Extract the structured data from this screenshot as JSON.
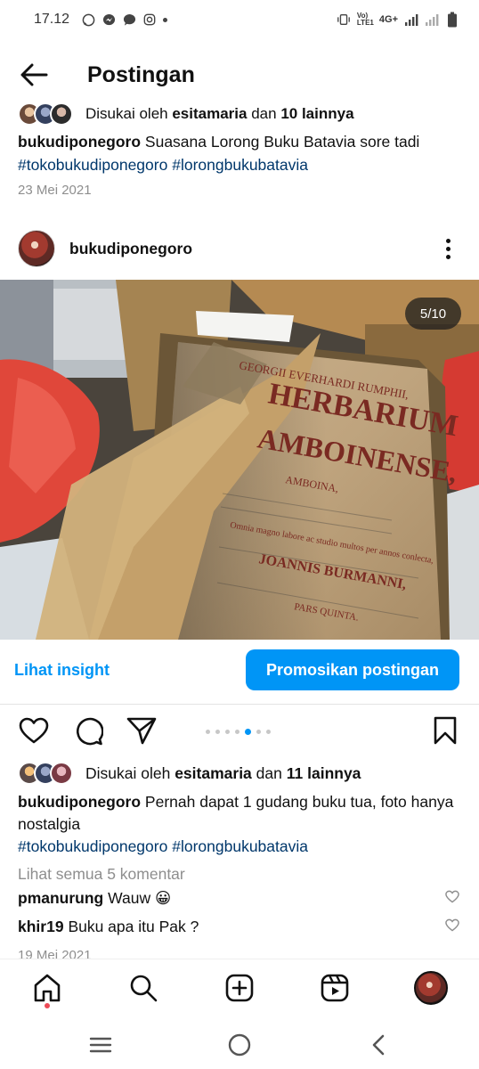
{
  "status_bar": {
    "time": "17.12",
    "network_label": "Vo) LTE1",
    "network_type": "4G+"
  },
  "header": {
    "title": "Postingan"
  },
  "prev_post": {
    "likes_prefix": "Disukai oleh",
    "likes_user": "esitamaria",
    "likes_conj": "dan",
    "likes_others": "10 lainnya",
    "caption_user": "bukudiponegoro",
    "caption_text": "Suasana Lorong Buku Batavia sore tadi",
    "hashtag1": "#tokobukudiponegoro",
    "hashtag2": "#lorongbukubatavia",
    "date": "23 Mei 2021"
  },
  "post": {
    "username": "bukudiponegoro",
    "image_counter": "5/10",
    "image_text": {
      "line1": "GEORGII EVERHARDI RUMPHII,",
      "line2": "HERBARIUM",
      "line3": "AMBOINENSE,",
      "line4": "AMBOINA,",
      "line5": "Omnia magno labore ac studio multos per annos conlecta,",
      "line6": "JOANNIS BURMANNI,",
      "line7": "PARS QUINTA."
    },
    "insight_label": "Lihat insight",
    "promote_label": "Promosikan postingan",
    "carousel_total": 7,
    "carousel_active": 4,
    "likes_prefix": "Disukai oleh",
    "likes_user": "esitamaria",
    "likes_conj": "dan",
    "likes_others": "11 lainnya",
    "caption_user": "bukudiponegoro",
    "caption_text": "Pernah dapat 1 gudang buku tua, foto hanya nostalgia",
    "hashtag1": "#tokobukudiponegoro",
    "hashtag2": "#lorongbukubatavia",
    "view_comments": "Lihat semua 5 komentar",
    "comments": [
      {
        "user": "pmanurung",
        "text": "Wauw 😀"
      },
      {
        "user": "khir19",
        "text": "Buku apa itu Pak ?"
      }
    ],
    "date": "19 Mei 2021"
  },
  "colors": {
    "accent": "#0095f6",
    "hashtag": "#00376b",
    "muted": "#8e8e8e",
    "notification": "#ed4956"
  },
  "icons": {
    "status": [
      "whatsapp-icon",
      "messenger-icon",
      "chat-icon",
      "instagram-icon",
      "vibrate-icon",
      "signal-icon",
      "battery-icon"
    ],
    "actions": [
      "heart-icon",
      "comment-icon",
      "share-icon",
      "bookmark-icon"
    ],
    "nav": [
      "home-icon",
      "search-icon",
      "create-icon",
      "reels-icon",
      "profile-avatar"
    ],
    "system": [
      "recents-icon",
      "home-circle-icon",
      "back-chevron-icon"
    ]
  }
}
